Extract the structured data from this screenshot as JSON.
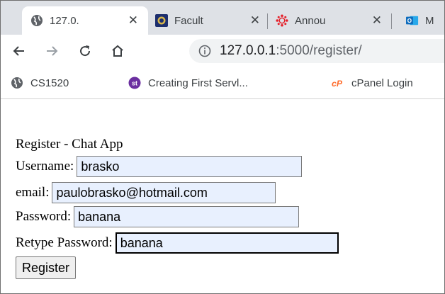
{
  "tabs": [
    {
      "title": "127.0.",
      "icon": "globe-icon",
      "active": true
    },
    {
      "title": "Facult",
      "icon": "university-seal-icon",
      "active": false
    },
    {
      "title": "Annou",
      "icon": "canvas-logo-icon",
      "active": false
    },
    {
      "title": "M",
      "icon": "outlook-icon",
      "active": false
    }
  ],
  "toolbar": {
    "url_host": "127.0.0.1",
    "url_path": ":5000/register/"
  },
  "bookmarks": [
    {
      "label": "CS1520",
      "icon": "globe-icon"
    },
    {
      "label": "Creating First Servl...",
      "icon": "st-icon"
    },
    {
      "label": "cPanel Login",
      "icon": "cpanel-icon"
    }
  ],
  "page": {
    "heading": "Register - Chat App",
    "username_label": "Username:",
    "username_value": "brasko",
    "email_label": "email:",
    "email_value": "paulobrasko@hotmail.com",
    "password_label": "Password:",
    "password_value": "banana",
    "retype_label": "Retype Password:",
    "retype_value": "banana",
    "register_label": "Register"
  },
  "colors": {
    "tabstrip_bg": "#dee1e6",
    "field_bg": "#e8f0fe",
    "canvas_red": "#e4202a",
    "outlook_blue": "#0f6cbd",
    "st_purple": "#6b2fa0",
    "cpanel_orange": "#ff6c2c"
  }
}
